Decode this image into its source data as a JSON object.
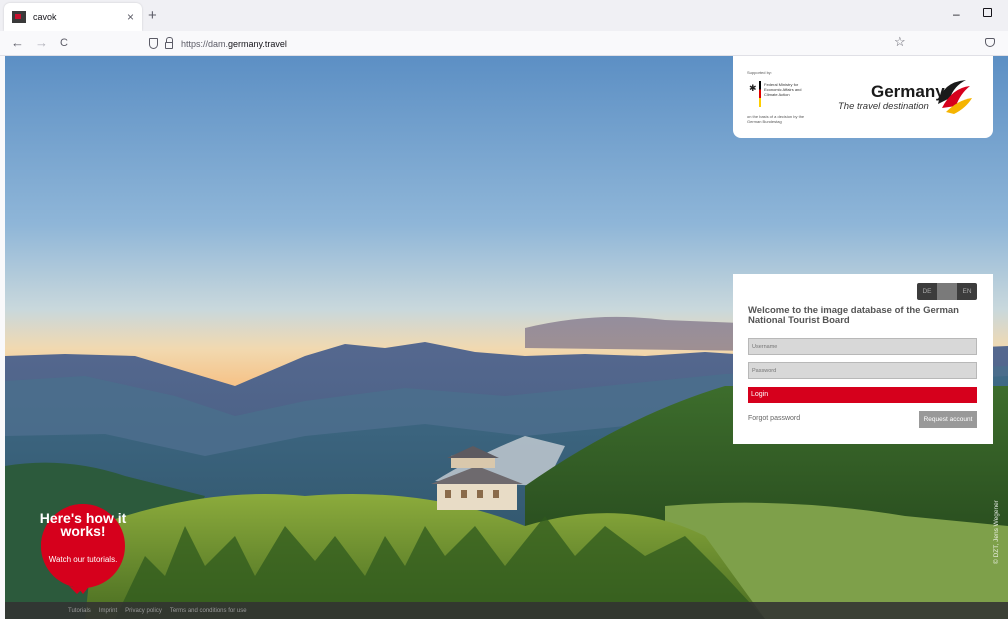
{
  "browser": {
    "tab_title": "cavok",
    "tab_close": "×",
    "new_tab": "+",
    "url_prefix": "https://dam.",
    "url_domain": "germany.travel",
    "back": "←",
    "forward": "→",
    "reload": "C",
    "star": "☆",
    "minimize": "–",
    "icons": [
      "favicon",
      "shield-icon",
      "lock-icon",
      "star-icon",
      "pocket-icon"
    ]
  },
  "logo": {
    "supported_by": "Supported by:",
    "ministry": "Federal Ministry for Economic Affairs and Climate Action",
    "resolution": "on the basis of a decision by the German Bundestag",
    "brand": "Germany",
    "tagline": "The travel destination"
  },
  "login": {
    "lang_de": "DE",
    "lang_en": "EN",
    "welcome": "Welcome to the image database of the German National Tourist Board",
    "username_placeholder": "Username",
    "password_placeholder": "Password",
    "login_label": "Login",
    "forgot_password": "Forgot password",
    "request_account": "Request account"
  },
  "tutorial": {
    "headline": "Here's how it works!",
    "subline": "Watch our tutorials."
  },
  "credit": "© DZT, Jens Wegener",
  "footer": {
    "links": [
      "Tutorials",
      "Imprint",
      "Privacy policy",
      "Terms and conditions for use"
    ]
  },
  "colors": {
    "brand_red": "#d6001c",
    "footer_bg": "#323232"
  }
}
